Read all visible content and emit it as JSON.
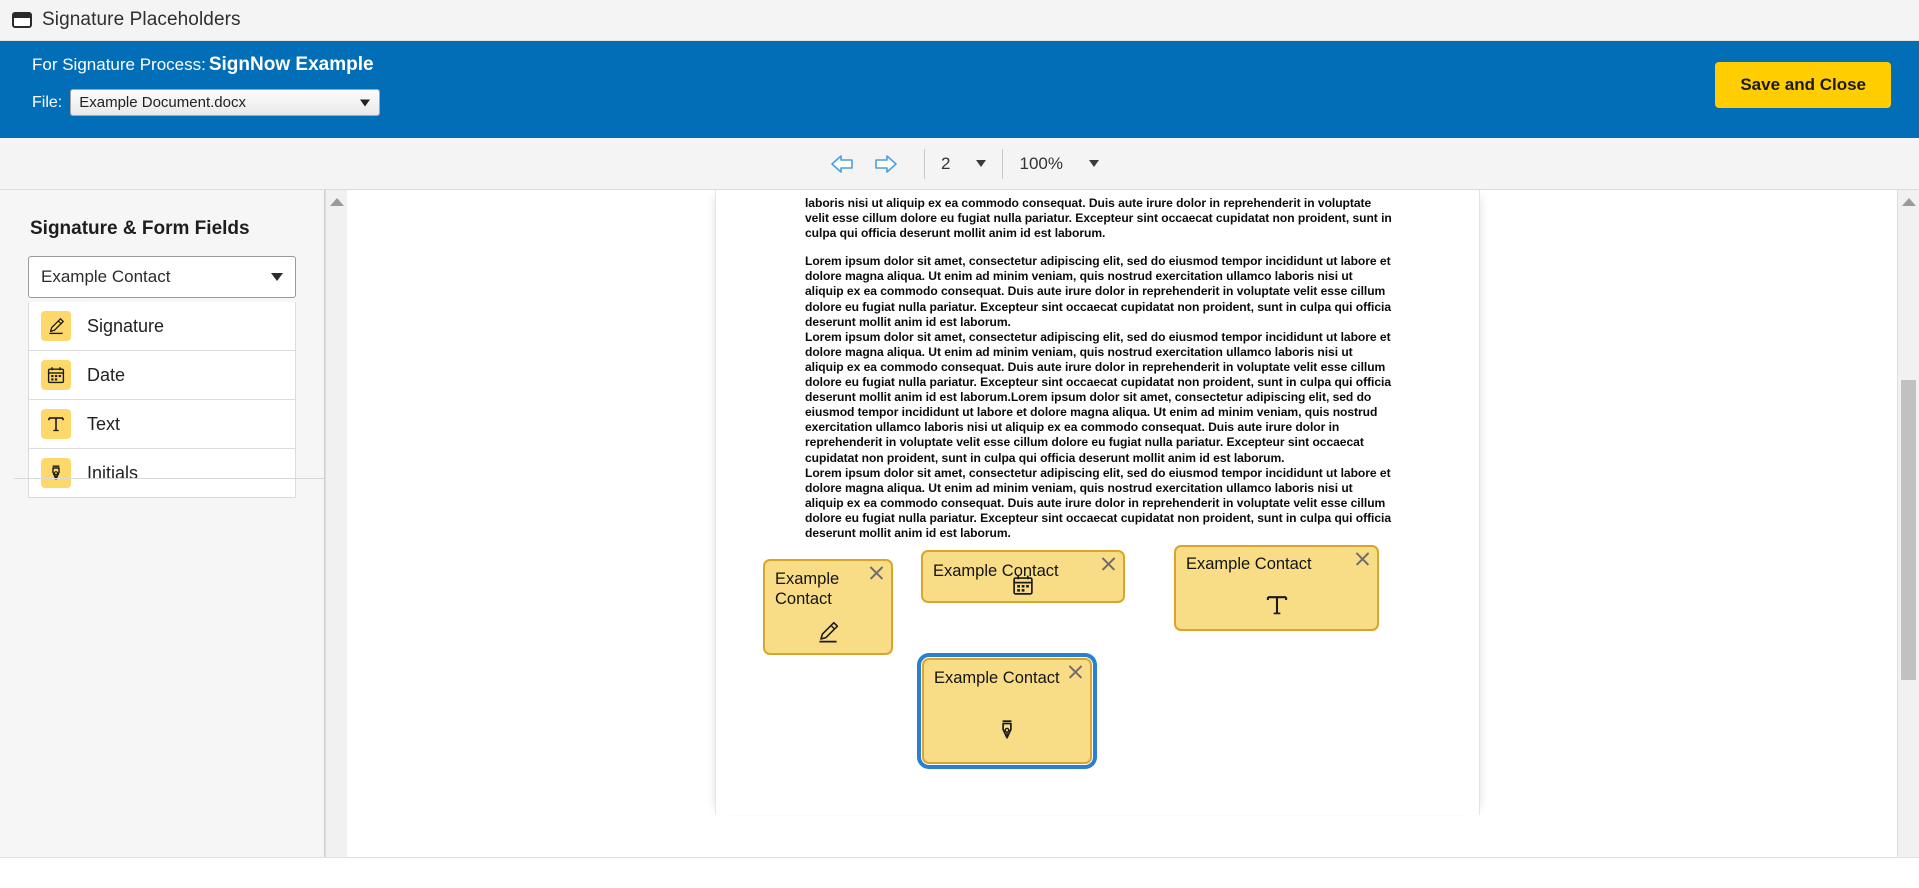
{
  "window": {
    "title": "Signature Placeholders",
    "icon": "window-icon"
  },
  "header": {
    "process_label": "For Signature Process:",
    "process_name": "SignNow Example",
    "file_label": "File:",
    "file_value": "Example Document.docx",
    "save_button": "Save and Close",
    "accent_blue": "#036eb8",
    "accent_yellow": "#ffcd00"
  },
  "toolbar": {
    "prev_icon": "arrow-left-icon",
    "next_icon": "arrow-right-icon",
    "page_value": "2",
    "page_caret_icon": "chevron-down-icon",
    "zoom_value": "100%",
    "zoom_caret_icon": "chevron-down-icon"
  },
  "sidebar": {
    "title": "Signature & Form Fields",
    "contact_value": "Example Contact",
    "contact_caret_icon": "chevron-down-icon",
    "fields": [
      {
        "label": "Signature",
        "icon": "pen-highlighter-icon"
      },
      {
        "label": "Date",
        "icon": "calendar-icon"
      },
      {
        "label": "Text",
        "icon": "text-t-icon"
      },
      {
        "label": "Initials",
        "icon": "fountain-pen-nib-icon"
      }
    ]
  },
  "document": {
    "paragraphs": [
      "laboris nisi ut aliquip ex ea commodo consequat. Duis aute irure dolor in reprehenderit in voluptate velit esse cillum dolore eu fugiat nulla pariatur. Excepteur sint occaecat cupidatat non proident, sunt in culpa qui officia deserunt mollit anim id est laborum.",
      "Lorem ipsum dolor sit amet, consectetur adipiscing elit, sed do eiusmod tempor incididunt ut labore et dolore magna aliqua. Ut enim ad minim veniam, quis nostrud exercitation ullamco laboris nisi ut aliquip ex ea commodo consequat. Duis aute irure dolor in reprehenderit in voluptate velit esse cillum dolore eu fugiat nulla pariatur. Excepteur sint occaecat cupidatat non proident, sunt in culpa qui officia deserunt mollit anim id est laborum.",
      "Lorem ipsum dolor sit amet, consectetur adipiscing elit, sed do eiusmod tempor incididunt ut labore et dolore magna aliqua. Ut enim ad minim veniam, quis nostrud exercitation ullamco laboris nisi ut aliquip ex ea commodo consequat. Duis aute irure dolor in reprehenderit in voluptate velit esse cillum dolore eu fugiat nulla pariatur. Excepteur sint occaecat cupidatat non proident, sunt in culpa qui officia deserunt mollit anim id est laborum.Lorem ipsum dolor sit amet, consectetur adipiscing elit, sed do eiusmod tempor incididunt ut labore et dolore magna aliqua. Ut enim ad minim veniam, quis nostrud exercitation ullamco laboris nisi ut aliquip ex ea commodo consequat. Duis aute irure dolor in reprehenderit in voluptate velit esse cillum dolore eu fugiat nulla pariatur. Excepteur sint occaecat cupidatat non proident, sunt in culpa qui officia deserunt mollit anim id est laborum.",
      "Lorem ipsum dolor sit amet, consectetur adipiscing elit, sed do eiusmod tempor incididunt ut labore et dolore magna aliqua. Ut enim ad minim veniam, quis nostrud exercitation ullamco laboris nisi ut aliquip ex ea commodo consequat. Duis aute irure dolor in reprehenderit in voluptate velit esse cillum dolore eu fugiat nulla pariatur. Excepteur sint occaecat cupidatat non proident, sunt in culpa qui officia deserunt mollit anim id est laborum."
    ],
    "placeholders": [
      {
        "label": "Example Contact",
        "type": "signature",
        "icon": "pen-highlighter-icon",
        "close_icon": "close-icon",
        "selected": false
      },
      {
        "label": "Example Contact",
        "type": "date",
        "icon": "calendar-icon",
        "close_icon": "close-icon",
        "selected": false
      },
      {
        "label": "Example Contact",
        "type": "text",
        "icon": "text-t-icon",
        "close_icon": "close-icon",
        "selected": false
      },
      {
        "label": "Example Contact",
        "type": "initials",
        "icon": "fountain-pen-nib-icon",
        "close_icon": "close-icon",
        "selected": true
      }
    ],
    "placeholder_fill": "#f9dc86",
    "placeholder_border": "#d8a62c",
    "selection_color": "#2a7fd0"
  },
  "scrollbars": {
    "sidebar_up_icon": "scroll-up-arrow",
    "sidebar_down_icon": "scroll-down-arrow",
    "viewer_up_icon": "scroll-up-arrow",
    "viewer_down_icon": "scroll-down-arrow",
    "h_left_icon": "scroll-left-arrow",
    "h_right_icon": "scroll-right-arrow"
  }
}
